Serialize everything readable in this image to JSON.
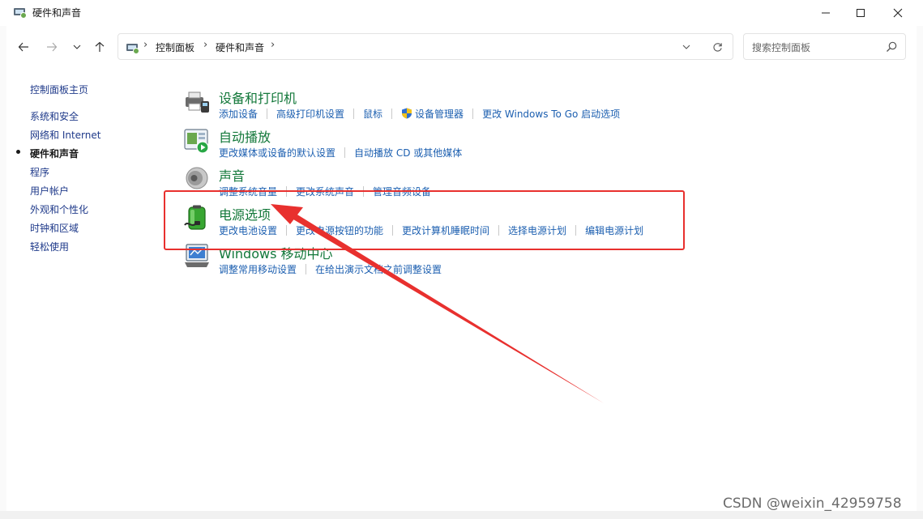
{
  "window": {
    "title": "硬件和声音"
  },
  "nav": {
    "path": [
      "控制面板",
      "硬件和声音"
    ]
  },
  "search": {
    "placeholder": "搜索控制面板"
  },
  "sidebar": {
    "home": "控制面板主页",
    "items": [
      "系统和安全",
      "网络和 Internet",
      "硬件和声音",
      "程序",
      "用户帐户",
      "外观和个性化",
      "时钟和区域",
      "轻松使用"
    ],
    "current_index": 2
  },
  "categories": [
    {
      "title": "设备和打印机",
      "icon": "printer-icon",
      "links": [
        "添加设备",
        "高级打印机设置",
        "鼠标",
        "设备管理器",
        "更改 Windows To Go 启动选项"
      ]
    },
    {
      "title": "自动播放",
      "icon": "autoplay-icon",
      "links": [
        "更改媒体或设备的默认设置",
        "自动播放 CD 或其他媒体"
      ]
    },
    {
      "title": "声音",
      "icon": "speaker-icon",
      "links": [
        "调整系统音量",
        "更改系统声音",
        "管理音频设备"
      ]
    },
    {
      "title": "电源选项",
      "icon": "battery-icon",
      "links": [
        "更改电池设置",
        "更改电源按钮的功能",
        "更改计算机睡眠时间",
        "选择电源计划",
        "编辑电源计划"
      ]
    },
    {
      "title": "Windows 移动中心",
      "icon": "mobility-center-icon",
      "links": [
        "调整常用移动设置",
        "在给出演示文档之前调整设置"
      ]
    }
  ],
  "watermark": "CSDN @weixin_42959758",
  "colors": {
    "category_title": "#13783a",
    "link": "#1c5fb0",
    "annotation": "#e8302e"
  }
}
